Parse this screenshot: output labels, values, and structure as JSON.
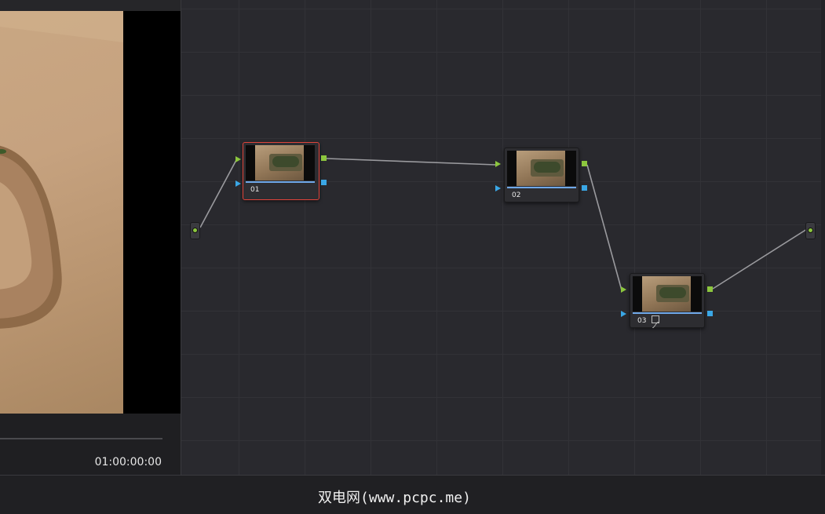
{
  "viewer": {
    "timecode": "01:00:00:00"
  },
  "node_graph": {
    "nodes": [
      {
        "label": "01",
        "selected": true
      },
      {
        "label": "02",
        "selected": false
      },
      {
        "label": "03",
        "selected": false,
        "badge_icon": "curves-icon"
      }
    ],
    "connections": [
      [
        "source-input",
        "01"
      ],
      [
        "01",
        "02"
      ],
      [
        "02",
        "03"
      ],
      [
        "03",
        "output"
      ]
    ]
  },
  "footer": {
    "watermark": "双电网(www.pcpc.me)"
  },
  "colors": {
    "rgb_port": "#8cc63e",
    "key_port": "#3aa7e6",
    "selection_border": "#e0443a",
    "link_line": "#9a9a9e"
  }
}
